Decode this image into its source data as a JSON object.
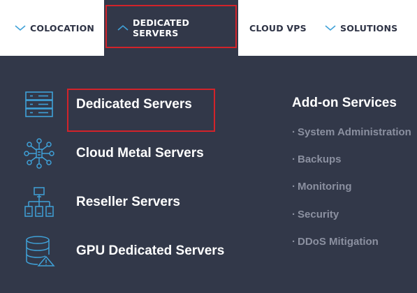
{
  "nav": {
    "items": [
      {
        "label": "COLOCATION",
        "chevron": "chevron-down-icon"
      },
      {
        "label": "DEDICATED SERVERS",
        "chevron": "chevron-up-icon",
        "active": true
      },
      {
        "label": "CLOUD VPS"
      },
      {
        "label": "SOLUTIONS",
        "chevron": "chevron-down-icon"
      }
    ]
  },
  "menu": {
    "items": [
      {
        "label": "Dedicated Servers",
        "icon": "server-rack-icon"
      },
      {
        "label": "Cloud Metal Servers",
        "icon": "network-hub-icon"
      },
      {
        "label": "Reseller Servers",
        "icon": "hierarchy-icon"
      },
      {
        "label": "GPU Dedicated Servers",
        "icon": "database-warning-icon"
      }
    ]
  },
  "addons": {
    "title": "Add-on Services",
    "items": [
      "System Administration",
      "Backups",
      "Monitoring",
      "Security",
      "DDoS Mitigation"
    ]
  },
  "colors": {
    "dropdown_bg": "#323849",
    "icon_blue": "#3fa1d8",
    "highlight_red": "#d2232a",
    "addon_text": "#8b90a0"
  }
}
